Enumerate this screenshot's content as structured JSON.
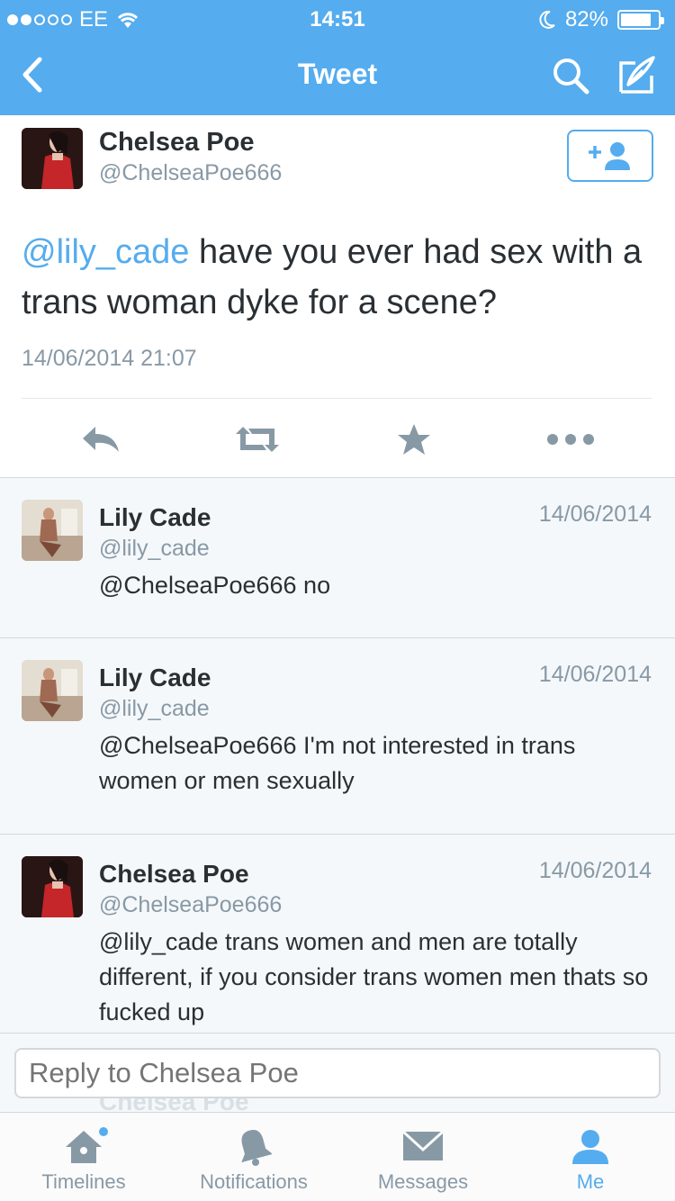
{
  "status_bar": {
    "carrier": "EE",
    "time": "14:51",
    "battery": "82%",
    "battery_level": 0.82
  },
  "nav": {
    "title": "Tweet"
  },
  "main_tweet": {
    "name": "Chelsea Poe",
    "handle": "@ChelseaPoe666",
    "mention": "@lily_cade",
    "text": " have you ever had sex with a trans woman dyke for a scene?",
    "date": "14/06/2014 21:07"
  },
  "replies": [
    {
      "name": "Lily Cade",
      "handle": "@lily_cade",
      "date": "14/06/2014",
      "text": "@ChelseaPoe666 no"
    },
    {
      "name": "Lily Cade",
      "handle": "@lily_cade",
      "date": "14/06/2014",
      "text": "@ChelseaPoe666 I'm not interested in trans women or men sexually"
    },
    {
      "name": "Chelsea Poe",
      "handle": "@ChelseaPoe666",
      "date": "14/06/2014",
      "text": "@lily_cade trans women and men are totally different, if you consider trans women men thats so fucked up"
    }
  ],
  "reply_box": {
    "placeholder": "Reply to Chelsea Poe",
    "ghost_name": "Chelsea Poe"
  },
  "tabs": [
    {
      "label": "Timelines",
      "icon": "home-icon"
    },
    {
      "label": "Notifications",
      "icon": "bell-icon"
    },
    {
      "label": "Messages",
      "icon": "envelope-icon"
    },
    {
      "label": "Me",
      "icon": "person-icon"
    }
  ],
  "colors": {
    "accent": "#55acee",
    "text": "#292f33",
    "muted": "#8899a6"
  }
}
